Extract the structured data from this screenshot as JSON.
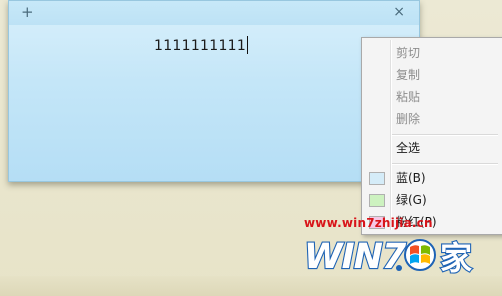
{
  "note": {
    "add_glyph": "+",
    "close_glyph": "×",
    "text": "1111111111",
    "color": "#c4e6f8"
  },
  "context_menu": {
    "items": [
      {
        "label": "剪切",
        "enabled": false
      },
      {
        "label": "复制",
        "enabled": false
      },
      {
        "label": "粘贴",
        "enabled": false
      },
      {
        "label": "删除",
        "enabled": false
      },
      {
        "label": "全选",
        "enabled": true
      },
      {
        "label": "蓝(B)",
        "enabled": true,
        "swatch": "#d5ecf8"
      },
      {
        "label": "绿(G)",
        "enabled": true,
        "swatch": "#cdf2c0"
      },
      {
        "label": "粉红(P)",
        "enabled": true,
        "swatch": "#f7c8e6"
      }
    ]
  },
  "watermark": {
    "url": "www.win7zhijia.cn",
    "logo_text": "WIN7.家",
    "colors": {
      "logo_blue": "#1e63b5",
      "url_red": "#d8141a"
    }
  }
}
